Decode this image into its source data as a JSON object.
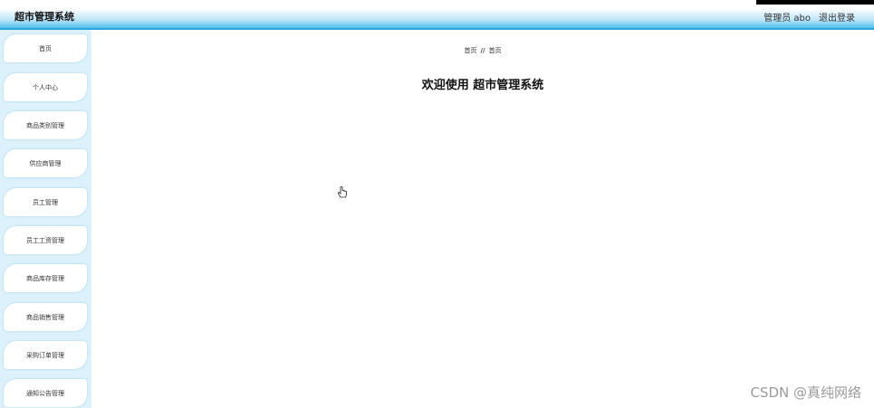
{
  "header": {
    "app_title": "超市管理系统",
    "user_label": "管理员 abo",
    "logout_label": "退出登录"
  },
  "sidebar": {
    "items": [
      {
        "label": "首页"
      },
      {
        "label": "个人中心"
      },
      {
        "label": "商品类别管理"
      },
      {
        "label": "供应商管理"
      },
      {
        "label": "员工管理"
      },
      {
        "label": "员工工资管理"
      },
      {
        "label": "商品库存管理"
      },
      {
        "label": "商品销售管理"
      },
      {
        "label": "采购订单管理"
      },
      {
        "label": "通知公告管理"
      }
    ]
  },
  "main": {
    "breadcrumb": {
      "root": "首页",
      "separator": "//",
      "current": "首页"
    },
    "welcome": "欢迎使用 超市管理系统"
  },
  "watermark": "CSDN @真纯网络",
  "colors": {
    "header_gradient_end": "#4fc0ec",
    "sidebar_bg": "#dcf1fb"
  }
}
